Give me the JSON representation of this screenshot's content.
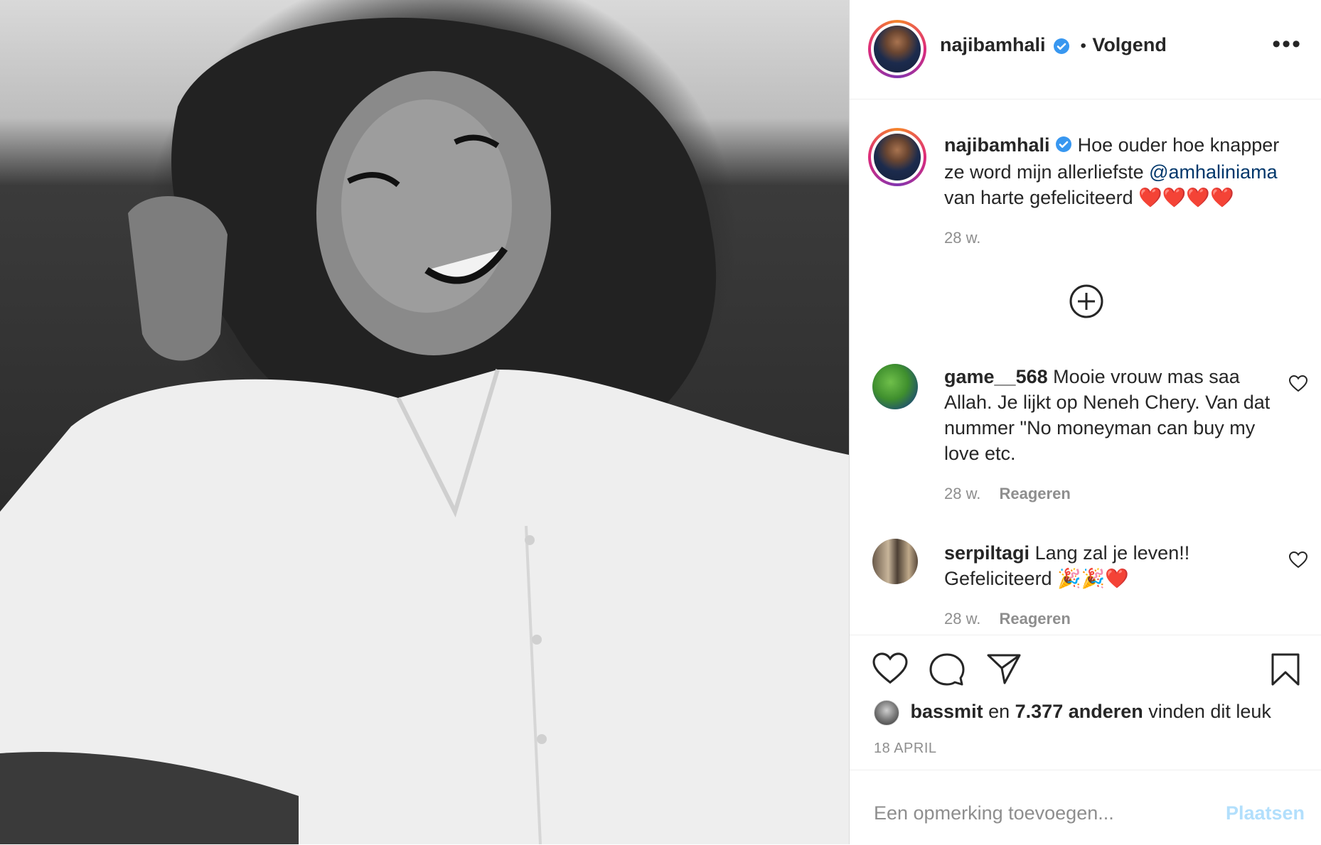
{
  "header": {
    "username": "najibamhali",
    "follow_separator": "•",
    "follow_label": "Volgend",
    "more_label": "•••"
  },
  "caption": {
    "username": "najibamhali",
    "text_before": "Hoe ouder hoe knapper ze word mijn allerliefste ",
    "mention": "@amhaliniama",
    "text_after": " van harte gefeliciteerd ❤️❤️❤️❤️",
    "time": "28 w."
  },
  "load_more_label": "⊕",
  "comments": [
    {
      "username": "game__568",
      "text": "Mooie vrouw mas saa Allah. Je lijkt op Neneh Chery. Van dat nummer \"No moneyman can buy my love etc.",
      "time": "28 w.",
      "reply_label": "Reageren"
    },
    {
      "username": "serpiltagi",
      "text": "Lang zal je leven!! Gefeliciteerd 🎉🎉❤️",
      "time": "28 w.",
      "reply_label": "Reageren"
    }
  ],
  "likes": {
    "first_user": "bassmit",
    "connector": "en",
    "count": "7.377 anderen",
    "suffix": "vinden dit leuk"
  },
  "date": "18 APRIL",
  "comment_input": {
    "placeholder": "Een opmerking toevoegen...",
    "post_label": "Plaatsen"
  },
  "colors": {
    "verified": "#3897f0",
    "link": "#00376b",
    "post_disabled": "#b2dffc",
    "secondary_text": "#8e8e8e"
  }
}
